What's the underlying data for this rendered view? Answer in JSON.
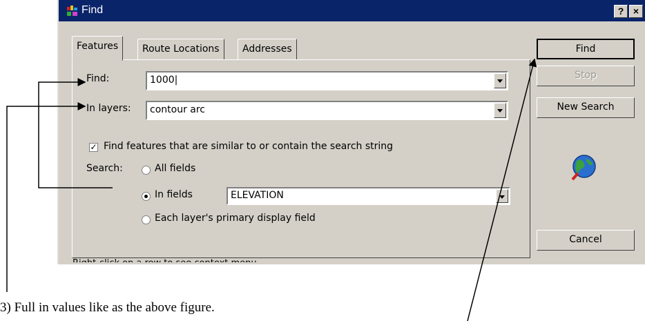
{
  "window": {
    "title": "Find",
    "help_button": "?",
    "close_button": "×"
  },
  "tabs": [
    {
      "label": "Features",
      "active": true
    },
    {
      "label": "Route Locations",
      "active": false
    },
    {
      "label": "Addresses",
      "active": false
    }
  ],
  "form": {
    "find_label": "Find:",
    "find_value": "1000|",
    "layers_label": "In layers:",
    "layers_value": "contour arc",
    "similar_checkbox_label": "Find features that are similar to or contain the search string",
    "similar_checked": true,
    "search_label": "Search:",
    "radio_all_fields": "All fields",
    "radio_in_fields": "In fields",
    "radio_primary": "Each layer's primary display field",
    "selected_radio": "In fields",
    "field_value": "ELEVATION"
  },
  "buttons": {
    "find": "Find",
    "stop": "Stop",
    "new_search": "New Search",
    "cancel": "Cancel"
  },
  "status_text": "Right-click on a row to see context menu",
  "caption": "3) Full in values like as the above figure.",
  "icons": [
    "app-icon",
    "globe-search-icon",
    "dropdown-arrow-icon"
  ]
}
